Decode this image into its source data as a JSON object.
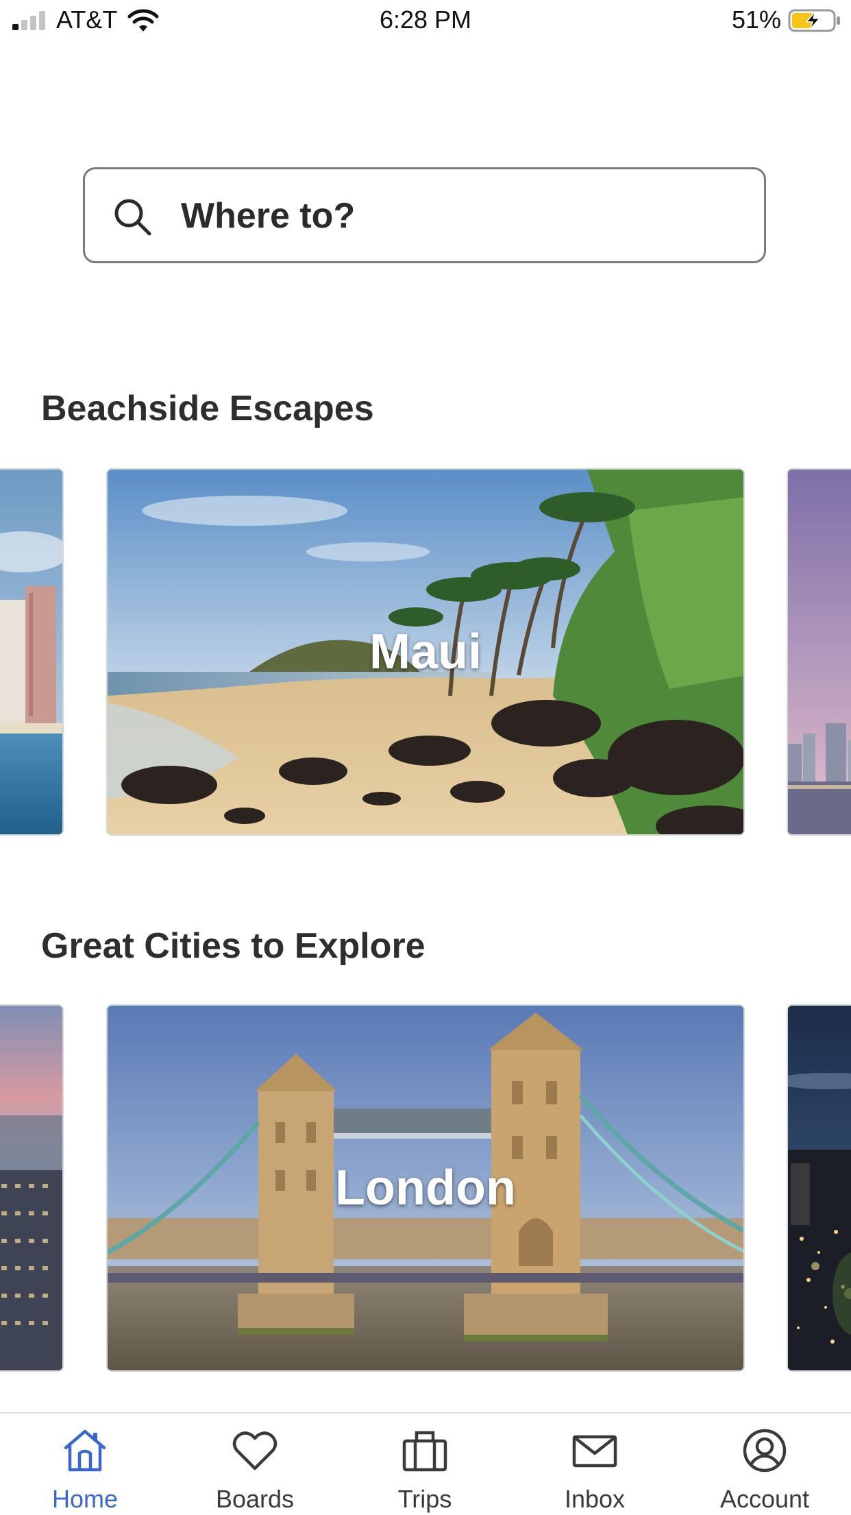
{
  "status_bar": {
    "carrier": "AT&T",
    "time": "6:28 PM",
    "battery": "51%",
    "signal_bars_active": 1,
    "signal_bars_total": 4,
    "battery_level": 0.51
  },
  "search": {
    "placeholder": "Where to?"
  },
  "sections": [
    {
      "title": "Beachside Escapes",
      "featured_card": {
        "label": "Maui"
      }
    },
    {
      "title": "Great Cities to Explore",
      "featured_card": {
        "label": "London"
      }
    }
  ],
  "tab_bar": {
    "tabs": [
      {
        "label": "Home",
        "icon": "home-icon",
        "active": true
      },
      {
        "label": "Boards",
        "icon": "heart-icon",
        "active": false
      },
      {
        "label": "Trips",
        "icon": "suitcase-icon",
        "active": false
      },
      {
        "label": "Inbox",
        "icon": "envelope-icon",
        "active": false
      },
      {
        "label": "Account",
        "icon": "user-circle-icon",
        "active": false
      }
    ]
  },
  "colors": {
    "active_tab": "#3b67c9",
    "inactive_tab": "#3a3a3a",
    "battery_fill": "#f5c518"
  }
}
